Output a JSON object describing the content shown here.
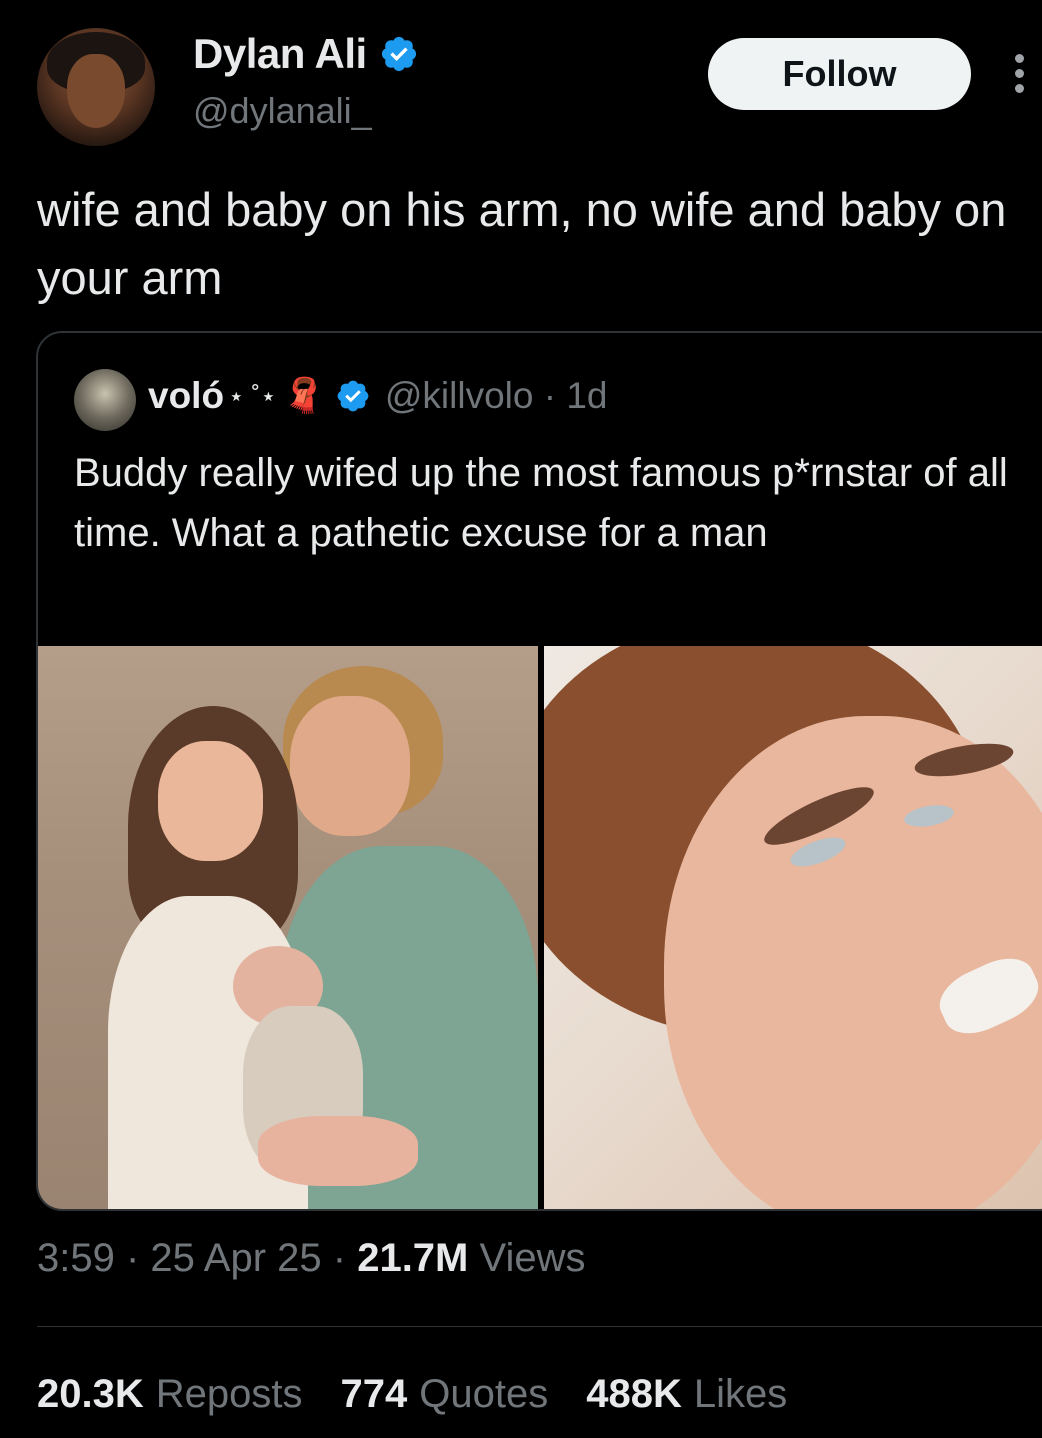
{
  "author": {
    "display_name": "Dylan Ali",
    "handle": "@dylanali_",
    "verified": true
  },
  "follow_label": "Follow",
  "tweet_text": "wife and baby on his arm, no wife and baby on your arm",
  "quoted": {
    "display_name": "voló",
    "decoration": "⋆ ˚⋆",
    "ribbon": "🧣",
    "handle": "@killvolo",
    "separator": " · ",
    "age": "1d",
    "text": "Buddy really wifed up the most famous p*rnstar of all time. What a pathetic excuse for a man",
    "media": [
      "family-photo",
      "closeup-face-photo"
    ]
  },
  "meta": {
    "time": "3:59",
    "sep1": " · ",
    "date": "25 Apr 25",
    "sep2": " · ",
    "views_count": "21.7M",
    "views_label": "Views"
  },
  "stats": {
    "reposts_count": "20.3K",
    "reposts_label": "Reposts",
    "quotes_count": "774",
    "quotes_label": "Quotes",
    "likes_count": "488K",
    "likes_label": "Likes"
  },
  "colors": {
    "background": "#000000",
    "text": "#e7e9ea",
    "muted": "#71767b",
    "verified": "#1d9bf0",
    "border": "#2f3336"
  }
}
